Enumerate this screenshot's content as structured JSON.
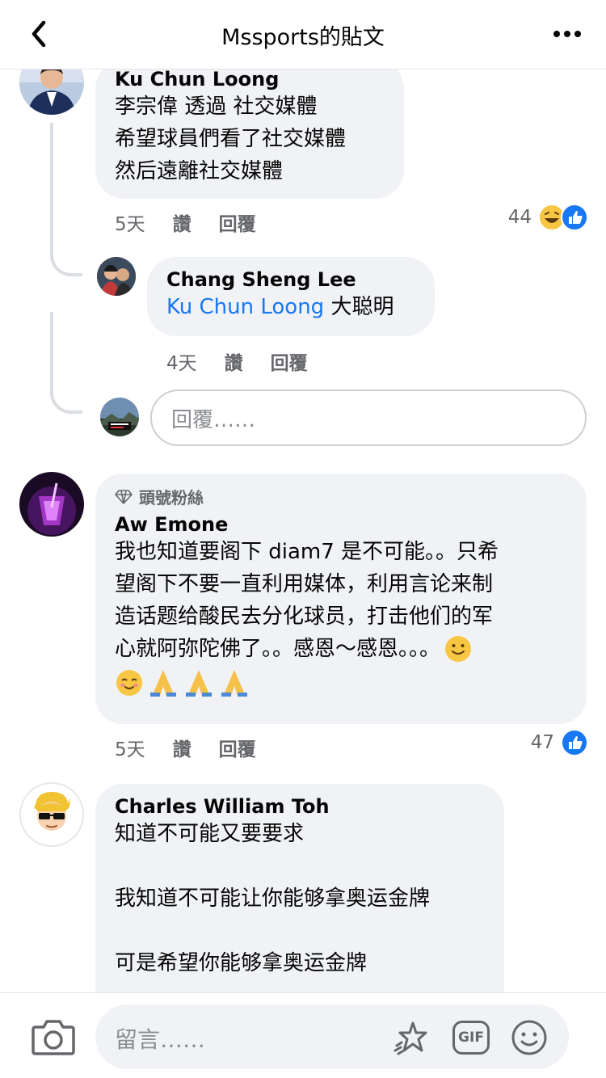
{
  "header": {
    "title": "Mssports的貼文"
  },
  "comments": [
    {
      "author": "Ku Chun Loong",
      "lines": [
        "李宗偉 透過 社交媒體",
        "希望球員們看了社交媒體",
        "然后遠離社交媒體"
      ],
      "time": "5天",
      "like": "讚",
      "reply": "回覆",
      "reaction_count": "44"
    },
    {
      "author": "Aw Emone",
      "badge": "頭號粉絲",
      "lines": [
        "我也知道要阁下 diam7 是不可能。。只希",
        "望阁下不要一直利用媒体，利用言论来制",
        "造话题给酸民去分化球员，打击他们的军",
        "心就阿弥陀佛了。。感恩～感恩。。。"
      ],
      "time": "5天",
      "like": "讚",
      "reply": "回覆",
      "reaction_count": "47"
    },
    {
      "author": "Charles William Toh",
      "lines": [
        "知道不可能又要要求",
        "",
        "我知道不可能让你能够拿奥运金牌",
        "",
        "可是希望你能够拿奥运金牌"
      ]
    }
  ],
  "reply": {
    "author": "Chang Sheng Lee",
    "mention": "Ku Chun Loong",
    "text": " 大聪明",
    "time": "4天",
    "like": "讚",
    "reply": "回覆"
  },
  "reply_input": {
    "placeholder": "回覆……"
  },
  "footer": {
    "placeholder": "留言……",
    "gif_label": "GIF"
  },
  "colors": {
    "like_blue": "#1877f2",
    "bubble": "#f0f2f5",
    "meta_gray": "#65676b"
  }
}
